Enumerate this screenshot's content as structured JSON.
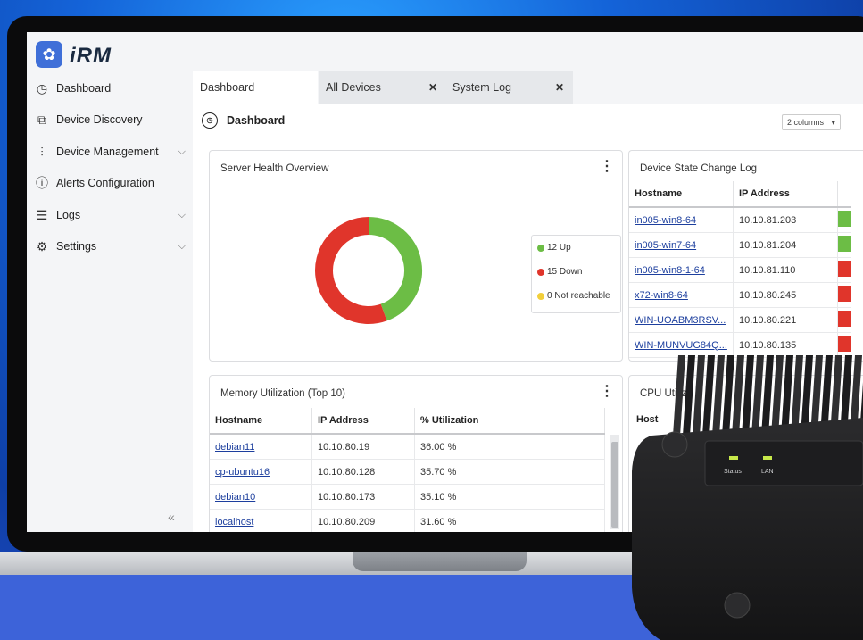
{
  "app": {
    "logo_text": "iRM"
  },
  "sidebar": {
    "items": [
      {
        "label": "Dashboard",
        "icon": "dashboard-icon",
        "has_submenu": false
      },
      {
        "label": "Device Discovery",
        "icon": "device-discovery-icon",
        "has_submenu": false
      },
      {
        "label": "Device Management",
        "icon": "sliders-icon",
        "has_submenu": true
      },
      {
        "label": "Alerts Configuration",
        "icon": "alert-icon",
        "has_submenu": false
      },
      {
        "label": "Logs",
        "icon": "logs-icon",
        "has_submenu": true
      },
      {
        "label": "Settings",
        "icon": "gear-icon",
        "has_submenu": true
      }
    ],
    "collapse_glyph": "«"
  },
  "tabs": [
    {
      "label": "Dashboard",
      "active": true,
      "closable": false
    },
    {
      "label": "All Devices",
      "active": false,
      "closable": true
    },
    {
      "label": "System Log",
      "active": false,
      "closable": true
    }
  ],
  "page": {
    "title": "Dashboard",
    "columns_select": "2 columns"
  },
  "server_health": {
    "title": "Server Health Overview",
    "chart_data": {
      "type": "pie",
      "categories": [
        "Up",
        "Down",
        "Not reachable"
      ],
      "values": [
        12,
        15,
        0
      ],
      "colors": [
        "#6cbd45",
        "#e0352b",
        "#f2cf3b"
      ]
    },
    "legend": [
      "12 Up",
      "15 Down",
      "0 Not reachable"
    ]
  },
  "device_state_log": {
    "title": "Device State Change Log",
    "columns": [
      "Hostname",
      "IP Address"
    ],
    "rows": [
      {
        "hostname": "in005-win8-64",
        "ip": "10.10.81.203",
        "state_color": "#6cbd45"
      },
      {
        "hostname": "in005-win7-64",
        "ip": "10.10.81.204",
        "state_color": "#6cbd45"
      },
      {
        "hostname": "in005-win8-1-64",
        "ip": "10.10.81.110",
        "state_color": "#e0352b"
      },
      {
        "hostname": "x72-win8-64",
        "ip": "10.10.80.245",
        "state_color": "#e0352b"
      },
      {
        "hostname": "WIN-UOABM3RSV...",
        "ip": "10.10.80.221",
        "state_color": "#e0352b"
      },
      {
        "hostname": "WIN-MUNVUG84Q...",
        "ip": "10.10.80.135",
        "state_color": "#e0352b"
      }
    ]
  },
  "memory": {
    "title": "Memory Utilization (Top 10)",
    "columns": [
      "Hostname",
      "IP Address",
      "% Utilization"
    ],
    "rows": [
      {
        "hostname": "debian11",
        "ip": "10.10.80.19",
        "util": "36.00 %"
      },
      {
        "hostname": "cp-ubuntu16",
        "ip": "10.10.80.128",
        "util": "35.70 %"
      },
      {
        "hostname": "debian10",
        "ip": "10.10.80.173",
        "util": "35.10 %"
      },
      {
        "hostname": "localhost",
        "ip": "10.10.80.209",
        "util": "31.60 %"
      }
    ]
  },
  "cpu": {
    "title": "CPU Utiliz",
    "col0": "Host"
  },
  "device_panel": {
    "status_label": "Status",
    "lan_label": "LAN"
  }
}
